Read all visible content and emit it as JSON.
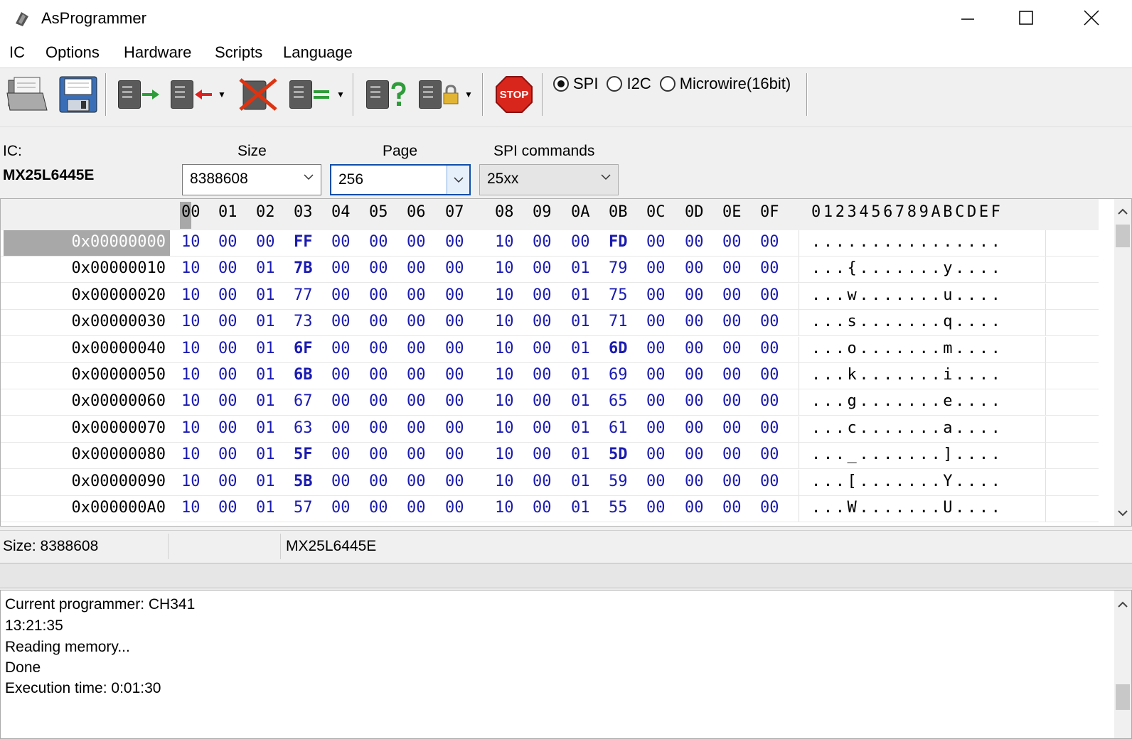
{
  "window": {
    "title": "AsProgrammer",
    "minimize": "—",
    "maximize": "☐",
    "close": "✕"
  },
  "menu": [
    "IC",
    "Options",
    "Hardware",
    "Scripts",
    "Language"
  ],
  "toolbar": {
    "interfaces": [
      {
        "label": "SPI",
        "selected": true
      },
      {
        "label": "I2C",
        "selected": false
      },
      {
        "label": "Microwire(16bit)",
        "selected": false
      }
    ]
  },
  "ic_panel": {
    "ic_label": "IC:",
    "ic_name": "MX25L6445E",
    "size_label": "Size",
    "size_value": "8388608",
    "page_label": "Page",
    "page_value": "256",
    "spi_label": "SPI commands",
    "spi_value": "25xx"
  },
  "hex": {
    "columns": [
      "00",
      "01",
      "02",
      "03",
      "04",
      "05",
      "06",
      "07",
      "08",
      "09",
      "0A",
      "0B",
      "0C",
      "0D",
      "0E",
      "0F"
    ],
    "ascii_header": "0123456789ABCDEF",
    "rows": [
      {
        "addr": "0x00000000",
        "bytes": [
          "10",
          "00",
          "00",
          "FF",
          "00",
          "00",
          "00",
          "00",
          "10",
          "00",
          "00",
          "FD",
          "00",
          "00",
          "00",
          "00"
        ],
        "ascii": "................"
      },
      {
        "addr": "0x00000010",
        "bytes": [
          "10",
          "00",
          "01",
          "7B",
          "00",
          "00",
          "00",
          "00",
          "10",
          "00",
          "01",
          "79",
          "00",
          "00",
          "00",
          "00"
        ],
        "ascii": "...{.......y...."
      },
      {
        "addr": "0x00000020",
        "bytes": [
          "10",
          "00",
          "01",
          "77",
          "00",
          "00",
          "00",
          "00",
          "10",
          "00",
          "01",
          "75",
          "00",
          "00",
          "00",
          "00"
        ],
        "ascii": "...w.......u...."
      },
      {
        "addr": "0x00000030",
        "bytes": [
          "10",
          "00",
          "01",
          "73",
          "00",
          "00",
          "00",
          "00",
          "10",
          "00",
          "01",
          "71",
          "00",
          "00",
          "00",
          "00"
        ],
        "ascii": "...s.......q...."
      },
      {
        "addr": "0x00000040",
        "bytes": [
          "10",
          "00",
          "01",
          "6F",
          "00",
          "00",
          "00",
          "00",
          "10",
          "00",
          "01",
          "6D",
          "00",
          "00",
          "00",
          "00"
        ],
        "ascii": "...o.......m...."
      },
      {
        "addr": "0x00000050",
        "bytes": [
          "10",
          "00",
          "01",
          "6B",
          "00",
          "00",
          "00",
          "00",
          "10",
          "00",
          "01",
          "69",
          "00",
          "00",
          "00",
          "00"
        ],
        "ascii": "...k.......i...."
      },
      {
        "addr": "0x00000060",
        "bytes": [
          "10",
          "00",
          "01",
          "67",
          "00",
          "00",
          "00",
          "00",
          "10",
          "00",
          "01",
          "65",
          "00",
          "00",
          "00",
          "00"
        ],
        "ascii": "...g.......e...."
      },
      {
        "addr": "0x00000070",
        "bytes": [
          "10",
          "00",
          "01",
          "63",
          "00",
          "00",
          "00",
          "00",
          "10",
          "00",
          "01",
          "61",
          "00",
          "00",
          "00",
          "00"
        ],
        "ascii": "...c.......a...."
      },
      {
        "addr": "0x00000080",
        "bytes": [
          "10",
          "00",
          "01",
          "5F",
          "00",
          "00",
          "00",
          "00",
          "10",
          "00",
          "01",
          "5D",
          "00",
          "00",
          "00",
          "00"
        ],
        "ascii": "..._.......]...."
      },
      {
        "addr": "0x00000090",
        "bytes": [
          "10",
          "00",
          "01",
          "5B",
          "00",
          "00",
          "00",
          "00",
          "10",
          "00",
          "01",
          "59",
          "00",
          "00",
          "00",
          "00"
        ],
        "ascii": "...[.......Y...."
      },
      {
        "addr": "0x000000A0",
        "bytes": [
          "10",
          "00",
          "01",
          "57",
          "00",
          "00",
          "00",
          "00",
          "10",
          "00",
          "01",
          "55",
          "00",
          "00",
          "00",
          "00"
        ],
        "ascii": "...W.......U...."
      }
    ]
  },
  "status": {
    "size_text": "Size: 8388608",
    "blank": "",
    "chip": "MX25L6445E"
  },
  "log": [
    "Current programmer: CH341",
    "13:21:35",
    "Reading memory...",
    "Done",
    "Execution time: 0:01:30"
  ],
  "colors": {
    "hex_byte": "#1a1ab0",
    "selected_addr_bg": "#a8a8a8",
    "stop_red": "#d9261c"
  }
}
